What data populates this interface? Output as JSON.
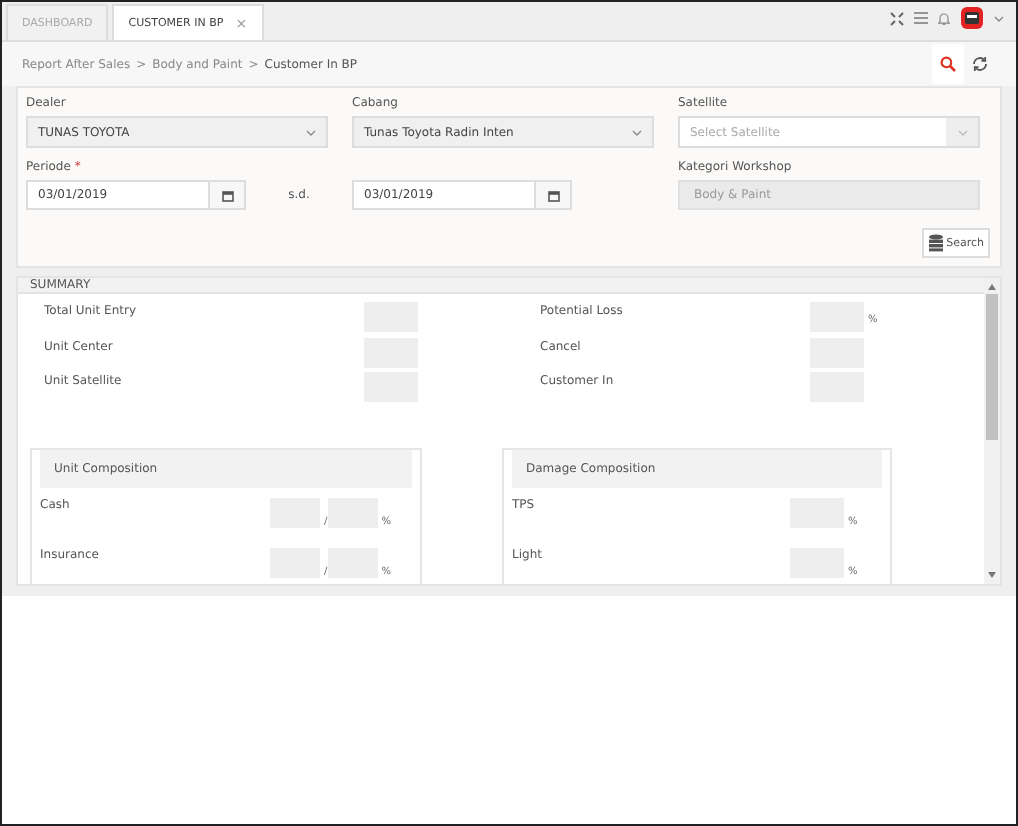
{
  "tabs": [
    {
      "label": "DASHBOARD",
      "selected": false
    },
    {
      "label": "CUSTOMER IN BP",
      "selected": true,
      "close": "×"
    }
  ],
  "breadcrumb": [
    "Report After Sales",
    "Body and Paint",
    "Customer In BP"
  ],
  "breadcrumb_separator": ">",
  "filters": [
    {
      "kind": "select",
      "label": "Dealer",
      "value": "TUNAS TOYOTA"
    },
    {
      "kind": "select",
      "label": "Cabang",
      "value": "Tunas Toyota Radin Inten"
    },
    {
      "kind": "select",
      "label": "Satellite",
      "placeholder": "Select Satellite",
      "disabled": true
    },
    {
      "kind": "daterange",
      "label": "Periode",
      "required_mark": "*",
      "from": "03/01/2019",
      "separator": "s.d.",
      "to": "03/01/2019"
    },
    {
      "kind": "spacer"
    },
    {
      "kind": "text",
      "label": "Kategori Workshop",
      "value": "Body & Paint",
      "disabled": true
    }
  ],
  "search_button": "Search",
  "summary": {
    "title": "SUMMARY",
    "left": [
      {
        "label": "Total Unit Entry"
      },
      {
        "label": "Unit Center"
      },
      {
        "label": "Unit Satellite"
      }
    ],
    "right": [
      {
        "label": "Potential Loss",
        "unit": "%"
      },
      {
        "label": "Cancel"
      },
      {
        "label": "Customer In"
      }
    ],
    "panels": [
      {
        "title": "Unit Composition",
        "rows": [
          {
            "kind": "pair",
            "label": "Cash",
            "divider": "/",
            "unit": "%"
          },
          {
            "kind": "pair",
            "label": "Insurance",
            "divider": "/",
            "unit": "%"
          }
        ]
      },
      {
        "title": "Damage Composition",
        "rows": [
          {
            "kind": "single",
            "label": "TPS",
            "unit": "%"
          },
          {
            "kind": "single",
            "label": "Light",
            "unit": "%"
          }
        ]
      }
    ]
  }
}
